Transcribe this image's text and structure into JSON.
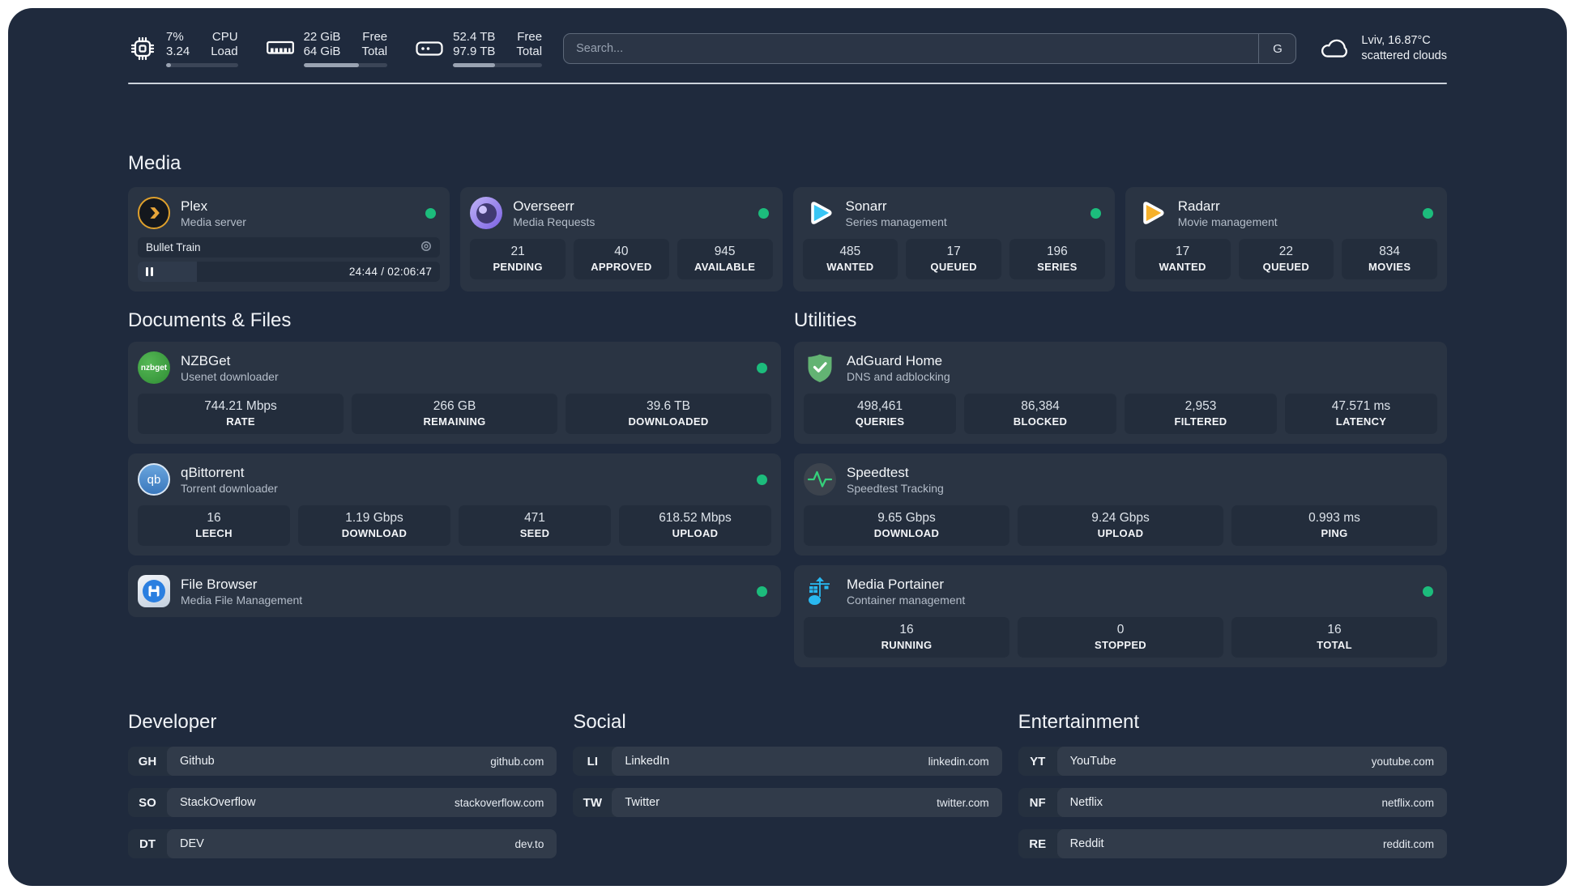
{
  "header": {
    "stats": [
      {
        "name": "cpu",
        "value_top": "7%",
        "value_bottom": "3.24",
        "label_top": "CPU",
        "label_bottom": "Load",
        "progress_pct": 7
      },
      {
        "name": "memory",
        "value_top": "22 GiB",
        "value_bottom": "64 GiB",
        "label_top": "Free",
        "label_bottom": "Total",
        "progress_pct": 66
      },
      {
        "name": "storage",
        "value_top": "52.4 TB",
        "value_bottom": "97.9 TB",
        "label_top": "Free",
        "label_bottom": "Total",
        "progress_pct": 47
      }
    ],
    "search": {
      "placeholder": "Search...",
      "button_label": "G"
    },
    "weather": {
      "location_temp": "Lviv, 16.87°C",
      "condition": "scattered clouds"
    }
  },
  "sections": {
    "media": {
      "title": "Media",
      "plex": {
        "title": "Plex",
        "subtitle": "Media server",
        "online": true,
        "now_playing": {
          "title": "Bullet Train",
          "time_label": "24:44 / 02:06:47",
          "progress_pct": 19.5,
          "state": "paused"
        }
      },
      "overseerr": {
        "title": "Overseerr",
        "subtitle": "Media Requests",
        "online": true,
        "stats": [
          {
            "value": "21",
            "label": "PENDING"
          },
          {
            "value": "40",
            "label": "APPROVED"
          },
          {
            "value": "945",
            "label": "AVAILABLE"
          }
        ]
      },
      "sonarr": {
        "title": "Sonarr",
        "subtitle": "Series management",
        "online": true,
        "stats": [
          {
            "value": "485",
            "label": "WANTED"
          },
          {
            "value": "17",
            "label": "QUEUED"
          },
          {
            "value": "196",
            "label": "SERIES"
          }
        ]
      },
      "radarr": {
        "title": "Radarr",
        "subtitle": "Movie management",
        "online": true,
        "stats": [
          {
            "value": "17",
            "label": "WANTED"
          },
          {
            "value": "22",
            "label": "QUEUED"
          },
          {
            "value": "834",
            "label": "MOVIES"
          }
        ]
      }
    },
    "documents": {
      "title": "Documents & Files",
      "nzbget": {
        "title": "NZBGet",
        "subtitle": "Usenet downloader",
        "online": true,
        "stats": [
          {
            "value": "744.21 Mbps",
            "label": "RATE"
          },
          {
            "value": "266 GB",
            "label": "REMAINING"
          },
          {
            "value": "39.6 TB",
            "label": "DOWNLOADED"
          }
        ]
      },
      "qbittorrent": {
        "title": "qBittorrent",
        "subtitle": "Torrent downloader",
        "online": true,
        "stats": [
          {
            "value": "16",
            "label": "LEECH"
          },
          {
            "value": "1.19 Gbps",
            "label": "DOWNLOAD"
          },
          {
            "value": "471",
            "label": "SEED"
          },
          {
            "value": "618.52 Mbps",
            "label": "UPLOAD"
          }
        ]
      },
      "filebrowser": {
        "title": "File Browser",
        "subtitle": "Media File Management",
        "online": true
      }
    },
    "utilities": {
      "title": "Utilities",
      "adguard": {
        "title": "AdGuard Home",
        "subtitle": "DNS and adblocking",
        "stats": [
          {
            "value": "498,461",
            "label": "QUERIES"
          },
          {
            "value": "86,384",
            "label": "BLOCKED"
          },
          {
            "value": "2,953",
            "label": "FILTERED"
          },
          {
            "value": "47.571 ms",
            "label": "LATENCY"
          }
        ]
      },
      "speedtest": {
        "title": "Speedtest",
        "subtitle": "Speedtest Tracking",
        "stats": [
          {
            "value": "9.65 Gbps",
            "label": "DOWNLOAD"
          },
          {
            "value": "9.24 Gbps",
            "label": "UPLOAD"
          },
          {
            "value": "0.993 ms",
            "label": "PING"
          }
        ]
      },
      "portainer": {
        "title": "Media Portainer",
        "subtitle": "Container management",
        "online": true,
        "stats": [
          {
            "value": "16",
            "label": "RUNNING"
          },
          {
            "value": "0",
            "label": "STOPPED"
          },
          {
            "value": "16",
            "label": "TOTAL"
          }
        ]
      }
    },
    "developer": {
      "title": "Developer",
      "links": [
        {
          "badge": "GH",
          "name": "Github",
          "url": "github.com"
        },
        {
          "badge": "SO",
          "name": "StackOverflow",
          "url": "stackoverflow.com"
        },
        {
          "badge": "DT",
          "name": "DEV",
          "url": "dev.to"
        }
      ]
    },
    "social": {
      "title": "Social",
      "links": [
        {
          "badge": "LI",
          "name": "LinkedIn",
          "url": "linkedin.com"
        },
        {
          "badge": "TW",
          "name": "Twitter",
          "url": "twitter.com"
        }
      ]
    },
    "entertainment": {
      "title": "Entertainment",
      "links": [
        {
          "badge": "YT",
          "name": "YouTube",
          "url": "youtube.com"
        },
        {
          "badge": "NF",
          "name": "Netflix",
          "url": "netflix.com"
        },
        {
          "badge": "RE",
          "name": "Reddit",
          "url": "reddit.com"
        }
      ]
    }
  },
  "icons": {
    "cpu": "cpu-chip-outline",
    "memory": "ram-stick-outline",
    "storage": "drive-outline",
    "weather": "cloud-outline",
    "plex": "gold-chevron-circle",
    "overseerr": "purple-eye-circle",
    "sonarr": "cyan-play-triangle",
    "radarr": "yellow-play-triangle",
    "nzbget_text": "nzbget",
    "qbittorrent_text": "qb",
    "filebrowser": "blue-floppy-circle",
    "adguard": "green-shield-check",
    "speedtest": "green-pulse-circle",
    "portainer": "blue-crane-containers",
    "plex_target": "record-ring",
    "pause": "pause-bars",
    "status_dot": "green-circle"
  },
  "colors": {
    "page_bg": "#1f2a3d",
    "card_bg": "#2a3443",
    "tile_bg": "#232d3c",
    "status_green": "#1cbc7c",
    "plex_gold": "#e9a63a",
    "sonarr_cyan": "#38c5f4",
    "radarr_yellow": "#f7b12b",
    "nzbget_green": "#3fa344",
    "qbittorrent_blue": "#4a8fd4",
    "filebrowser_blue": "#2b7fe0",
    "adguard_green": "#63b373",
    "speedtest_green": "#35d07a",
    "portainer_blue": "#29b8f0"
  }
}
